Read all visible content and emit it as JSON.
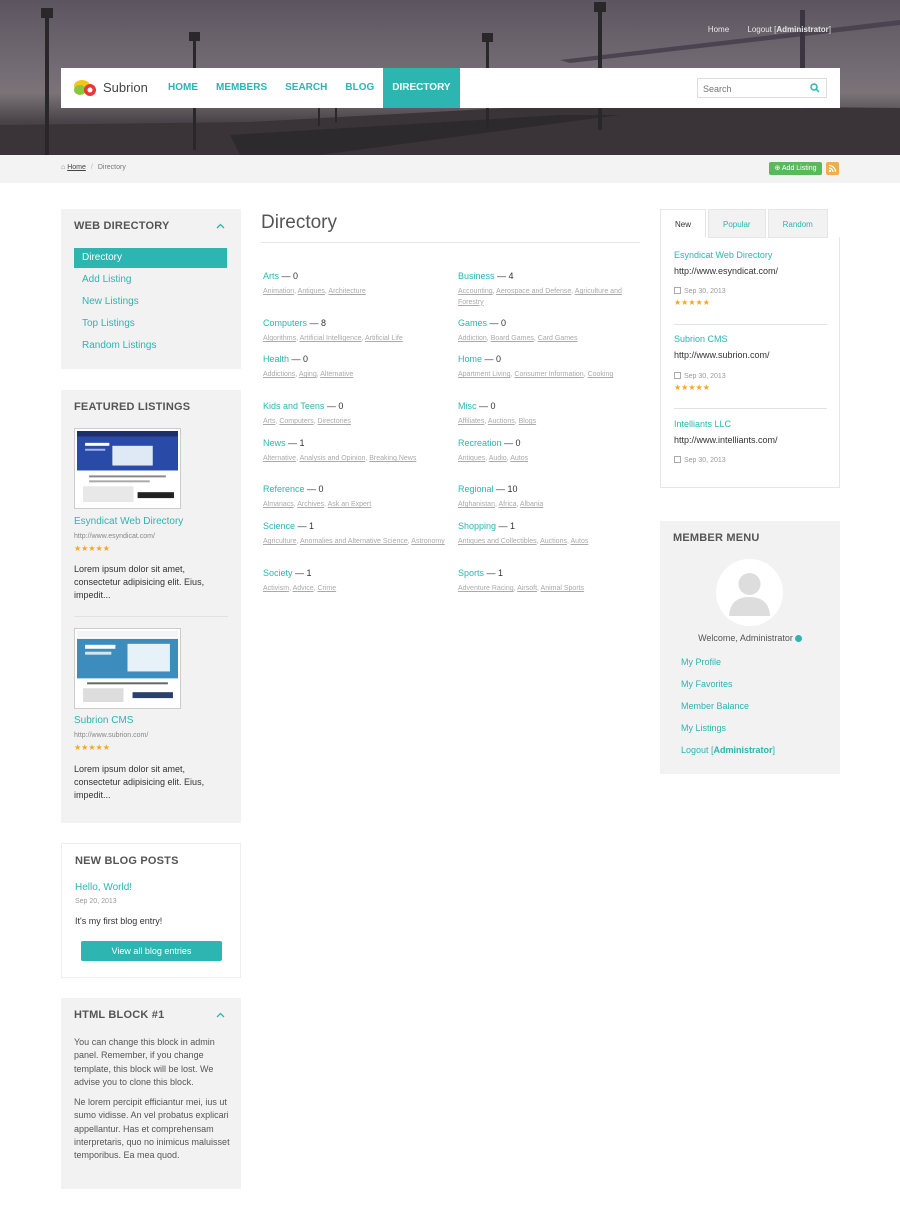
{
  "top_links": {
    "home": "Home",
    "logout_prefix": "Logout [",
    "logout_user": "Administrator",
    "logout_suffix": "]"
  },
  "navbar": {
    "brand": "Subrion",
    "menu": [
      "HOME",
      "MEMBERS",
      "SEARCH",
      "BLOG",
      "DIRECTORY"
    ],
    "active_index": 4,
    "search_placeholder": "Search"
  },
  "breadcrumb": {
    "home": "Home",
    "current": "Directory"
  },
  "actions": {
    "add_listing": "Add Listing"
  },
  "web_directory": {
    "title": "WEB DIRECTORY",
    "items": [
      "Directory",
      "Add Listing",
      "New Listings",
      "Top Listings",
      "Random Listings"
    ]
  },
  "featured": {
    "title": "FEATURED LISTINGS",
    "items": [
      {
        "title": "Esyndicat Web Directory",
        "url": "http://www.esyndicat.com/",
        "rating": "★★★★★",
        "desc": "Lorem ipsum dolor sit amet, consectetur adipisicing elit. Eius, impedit..."
      },
      {
        "title": "Subrion CMS",
        "url": "http://www.subrion.com/",
        "rating": "★★★★★",
        "desc": "Lorem ipsum dolor sit amet, consectetur adipisicing elit. Eius, impedit..."
      }
    ]
  },
  "blog": {
    "title": "NEW BLOG POSTS",
    "post_title": "Hello, World!",
    "post_date": "Sep 20, 2013",
    "post_text": "It's my first blog entry!",
    "button": "View all blog entries"
  },
  "html_block": {
    "title": "HTML BLOCK #1",
    "p1": "You can change this block in admin panel. Remember, if you change template, this block will be lost. We advise you to clone this block.",
    "p2": "Ne lorem percipit efficiantur mei, ius ut sumo vidisse. An vel probatus explicari appellantur. Has et comprehensam interpretaris, quo no inimicus maluisset temporibus. Ea mea quod."
  },
  "main": {
    "title": "Directory",
    "categories": [
      {
        "name": "Arts",
        "count": " — 0",
        "subs": [
          "Animation",
          "Antiques",
          "Architecture"
        ]
      },
      {
        "name": "Business",
        "count": " — 4",
        "subs": [
          "Accounting",
          "Aerospace and Defense",
          "Agriculture and Forestry"
        ]
      },
      {
        "name": "Computers",
        "count": " — 8",
        "subs": [
          "Algorithms",
          "Artificial Intelligence",
          "Artificial Life"
        ]
      },
      {
        "name": "Games",
        "count": " — 0",
        "subs": [
          "Addiction",
          "Board Games",
          "Card Games"
        ]
      },
      {
        "name": "Health",
        "count": " — 0",
        "subs": [
          "Addictions",
          "Aging",
          "Alternative"
        ]
      },
      {
        "name": "Home",
        "count": " — 0",
        "subs": [
          "Apartment Living",
          "Consumer Information",
          "Cooking"
        ]
      },
      {
        "name": "Kids and Teens",
        "count": " — 0",
        "subs": [
          "Arts",
          "Computers",
          "Directories"
        ]
      },
      {
        "name": "Misc",
        "count": " — 0",
        "subs": [
          "Affiliates",
          "Auctions",
          "Blogs"
        ]
      },
      {
        "name": "News",
        "count": " — 1",
        "subs": [
          "Alternative",
          "Analysis and Opinion",
          "Breaking News"
        ]
      },
      {
        "name": "Recreation",
        "count": " — 0",
        "subs": [
          "Antiques",
          "Audio",
          "Autos"
        ]
      },
      {
        "name": "Reference",
        "count": " — 0",
        "subs": [
          "Almanacs",
          "Archives",
          "Ask an Expert"
        ]
      },
      {
        "name": "Regional",
        "count": " — 10",
        "subs": [
          "Afghanistan",
          "Africa",
          "Albania"
        ]
      },
      {
        "name": "Science",
        "count": " — 1",
        "subs": [
          "Agriculture",
          "Anomalies and Alternative Science",
          "Astronomy"
        ]
      },
      {
        "name": "Shopping",
        "count": " — 1",
        "subs": [
          "Antiques and Collectibles",
          "Auctions",
          "Autos"
        ]
      },
      {
        "name": "Society",
        "count": " — 1",
        "subs": [
          "Activism",
          "Advice",
          "Crime"
        ]
      },
      {
        "name": "Sports",
        "count": " — 1",
        "subs": [
          "Adventure Racing",
          "Airsoft",
          "Animal Sports"
        ]
      }
    ]
  },
  "listing_tabs": {
    "tabs": [
      "New",
      "Popular",
      "Random"
    ],
    "items": [
      {
        "title": "Esyndicat Web Directory",
        "url": "http://www.esyndicat.com/",
        "date": "Sep 30, 2013",
        "rating": "★★★★★"
      },
      {
        "title": "Subrion CMS",
        "url": "http://www.subrion.com/",
        "date": "Sep 30, 2013",
        "rating": "★★★★★"
      },
      {
        "title": "Intelliants LLC",
        "url": "http://www.intelliants.com/",
        "date": "Sep 30, 2013",
        "rating": ""
      }
    ]
  },
  "member_menu": {
    "title": "MEMBER MENU",
    "welcome": "Welcome, Administrator",
    "links": [
      "My Profile",
      "My Favorites",
      "Member Balance",
      "My Listings"
    ],
    "logout_prefix": "Logout [",
    "logout_user": "Administrator",
    "logout_suffix": "]"
  },
  "colors": {
    "accent": "#2cb5b1",
    "add_button": "#5cb85c",
    "rss": "#f0ad4e",
    "stars": "#f5a623"
  }
}
